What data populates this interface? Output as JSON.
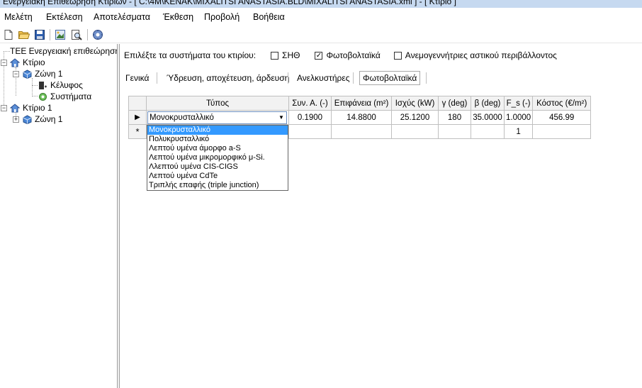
{
  "window": {
    "title": "Ενεργειακή Επιθεώρηση Κτιρίων - [ C:\\4M\\KENAK\\MIXALITSI ANASTASIA.BLD\\MIXALITSI ANASTASIA.xml ] - [ Κτίριο ]"
  },
  "menu": [
    "Μελέτη",
    "Εκτέλεση",
    "Αποτελέσματα",
    "Έκθεση",
    "Προβολή",
    "Βοήθεια"
  ],
  "toolbar": {
    "icons": [
      "new-icon",
      "open-folder-icon",
      "save-icon",
      "picture-icon",
      "print-preview-icon",
      "settings-icon"
    ]
  },
  "tree": {
    "root": "ΤΕΕ Ενεργειακή επιθεώρηση",
    "building1": "Κτίριο",
    "zone1": "Ζώνη 1",
    "envelope": "Κέλυφος",
    "systems": "Συστήματα",
    "building2": "Κτίριο 1",
    "zone2": "Ζώνη 1"
  },
  "systems": {
    "prompt": "Επιλέξτε τα συστήματα του κτιρίου:",
    "options": [
      {
        "label": "ΣΗΘ",
        "checked": false
      },
      {
        "label": "Φωτοβολταϊκά",
        "checked": true
      },
      {
        "label": "Ανεμογεννήτριες αστικού περιβάλλοντος",
        "checked": false
      }
    ]
  },
  "tabs": [
    "Γενικά",
    "Ύδρευση, αποχέτευση, άρδευση",
    "Ανελκυστήρες",
    "Φωτοβολταϊκά"
  ],
  "active_tab": "Φωτοβολταϊκά",
  "grid": {
    "columns": [
      "Τύπος",
      "Συν. Α. (-)",
      "Επιφάνεια (m²)",
      "Ισχύς (kW)",
      "γ (deg)",
      "β (deg)",
      "F_s (-)",
      "Κόστος (€/m²)"
    ],
    "row1": {
      "type": "Μονοκρυσταλλικό",
      "coef_a": "0.1900",
      "area": "14.8800",
      "power": "25.1200",
      "gamma": "180",
      "beta": "35.0000",
      "fs": "1.0000",
      "cost": "456.99"
    },
    "new_row": {
      "fs": "1"
    },
    "row_markers": {
      "current": "▶",
      "new": "*"
    }
  },
  "dropdown": {
    "options": [
      "Μονοκρυσταλλικό",
      "Πολυκρυσταλλικό",
      "Λεπτού υμένα άμορφο a-S",
      "Λεπτού υμένα μικρομορφικό μ-Si.",
      "Λλεπτού υμένα CIS-CIGS",
      "Λεπτού υμένα CdTe",
      "Τριπλής επαφής (triple junction)"
    ],
    "selected_index": 0
  }
}
